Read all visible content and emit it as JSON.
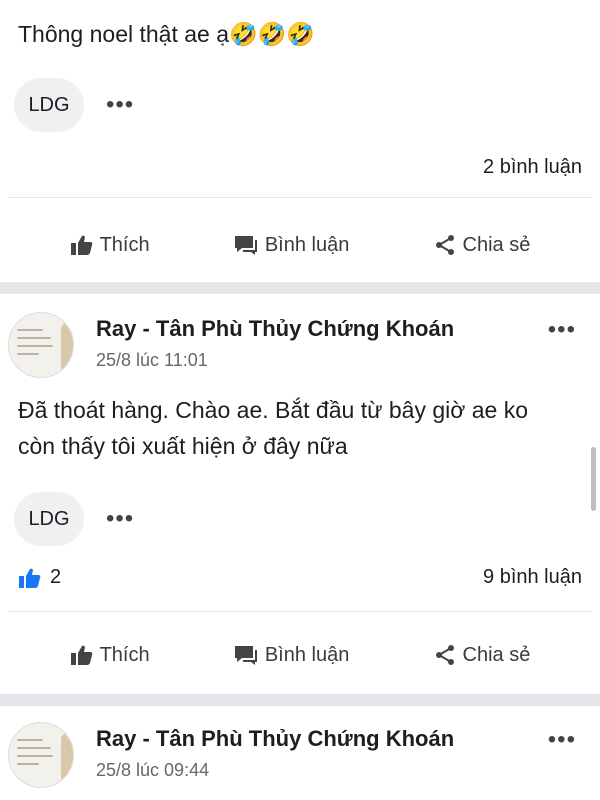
{
  "post_prev": {
    "text": "Thông noel thật ae ạ🤣🤣🤣",
    "chip": "LDG",
    "more": "•••",
    "comments": "2 bình luận"
  },
  "actions": {
    "like": "Thích",
    "comment": "Bình luận",
    "share": "Chia sẻ"
  },
  "post_1": {
    "author": "Ray - Tân Phù Thủy Chứng Khoán",
    "time": "25/8 lúc 11:01",
    "more": "•••",
    "text_line1": "Đã thoát hàng. Chào ae. Bắt đầu từ bây giờ ae ko",
    "text_line2": "còn thấy tôi xuất hiện ở đây nữa",
    "chip": "LDG",
    "chip_more": "•••",
    "likes": "2",
    "comments": "9 bình luận"
  },
  "post_2": {
    "author": "Ray - Tân Phù Thủy Chứng Khoán",
    "time": "25/8 lúc 09:44",
    "more": "•••"
  },
  "colors": {
    "like_blue": "#1877f2",
    "separator": "#e4e6eb",
    "secondary_text": "#65676b"
  }
}
